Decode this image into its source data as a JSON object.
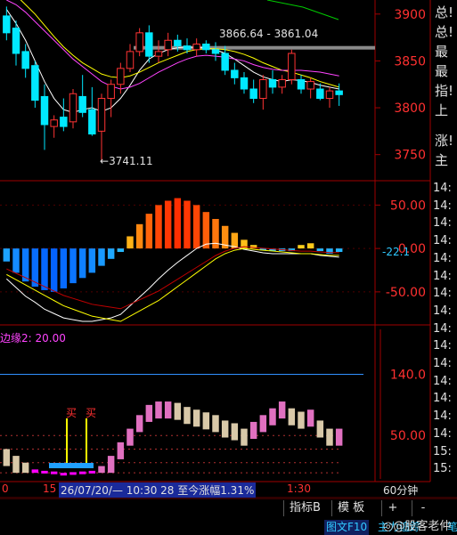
{
  "price_axis": {
    "ticks": [
      "3900",
      "3850",
      "3800",
      "3750"
    ]
  },
  "price_annotations": {
    "range_label": "3866.64 - 3861.04",
    "low_label": "3741.11"
  },
  "macd_axis": {
    "ticks": [
      "50.00",
      "0.00",
      "-50.00"
    ],
    "current_value": "-22.1"
  },
  "indicator_panel": {
    "title": "边缘2: 20.00",
    "ticks": [
      "140.0",
      "50.00"
    ],
    "buy_labels": [
      "买",
      "买"
    ]
  },
  "status_bar": {
    "left_text": "0",
    "left_text2": "15",
    "info_text": "26/07/20/— 10:30 28 至今涨幅1.31%",
    "time_text": "1:30",
    "period": "60分钟"
  },
  "right_panel": {
    "labels": [
      "总!",
      "总!",
      "最",
      "最",
      "指!",
      "上",
      "涨!",
      "主"
    ],
    "times": [
      "14:",
      "14:",
      "14:",
      "14:",
      "14:",
      "14:",
      "14:",
      "14:",
      "14:",
      "14:",
      "14:",
      "14:",
      "14:",
      "14:",
      "14:",
      "15:",
      "15:"
    ]
  },
  "bottom_buttons": {
    "indicator": "指标B",
    "template": "模 板",
    "plus": "+",
    "minus": "-"
  },
  "footer": {
    "tabs": "图文F10",
    "item2": "主力追踪",
    "item3": "笔"
  },
  "watermark": "股客老仲",
  "colors": {
    "up": "#ff3333",
    "down": "#00e8ff",
    "up_candle_fill": "#000000",
    "down_candle_fill": "#00e8ff"
  },
  "chart_data": [
    {
      "type": "candlestick",
      "title": "",
      "ylim": [
        3725,
        3915
      ],
      "yticks": [
        3900,
        3850,
        3800,
        3750
      ],
      "candles": [
        {
          "o": 3898,
          "h": 3908,
          "l": 3872,
          "c": 3880
        },
        {
          "o": 3885,
          "h": 3893,
          "l": 3845,
          "c": 3858
        },
        {
          "o": 3860,
          "h": 3868,
          "l": 3832,
          "c": 3842
        },
        {
          "o": 3845,
          "h": 3850,
          "l": 3800,
          "c": 3808
        },
        {
          "o": 3812,
          "h": 3825,
          "l": 3755,
          "c": 3782
        },
        {
          "o": 3780,
          "h": 3792,
          "l": 3768,
          "c": 3787
        },
        {
          "o": 3790,
          "h": 3810,
          "l": 3775,
          "c": 3780
        },
        {
          "o": 3785,
          "h": 3820,
          "l": 3778,
          "c": 3815
        },
        {
          "o": 3812,
          "h": 3835,
          "l": 3790,
          "c": 3795
        },
        {
          "o": 3798,
          "h": 3822,
          "l": 3770,
          "c": 3772
        },
        {
          "o": 3775,
          "h": 3815,
          "l": 3742,
          "c": 3810
        },
        {
          "o": 3810,
          "h": 3830,
          "l": 3790,
          "c": 3825
        },
        {
          "o": 3825,
          "h": 3848,
          "l": 3815,
          "c": 3842
        },
        {
          "o": 3842,
          "h": 3868,
          "l": 3838,
          "c": 3860
        },
        {
          "o": 3860,
          "h": 3885,
          "l": 3855,
          "c": 3880
        },
        {
          "o": 3880,
          "h": 3888,
          "l": 3848,
          "c": 3855
        },
        {
          "o": 3855,
          "h": 3872,
          "l": 3848,
          "c": 3860
        },
        {
          "o": 3862,
          "h": 3880,
          "l": 3855,
          "c": 3872
        },
        {
          "o": 3872,
          "h": 3878,
          "l": 3860,
          "c": 3866
        },
        {
          "o": 3866,
          "h": 3874,
          "l": 3858,
          "c": 3862
        },
        {
          "o": 3862,
          "h": 3874,
          "l": 3855,
          "c": 3868
        },
        {
          "o": 3868,
          "h": 3872,
          "l": 3858,
          "c": 3862
        },
        {
          "o": 3862,
          "h": 3870,
          "l": 3850,
          "c": 3858
        },
        {
          "o": 3858,
          "h": 3866,
          "l": 3835,
          "c": 3840
        },
        {
          "o": 3840,
          "h": 3848,
          "l": 3825,
          "c": 3832
        },
        {
          "o": 3832,
          "h": 3838,
          "l": 3815,
          "c": 3820
        },
        {
          "o": 3820,
          "h": 3830,
          "l": 3805,
          "c": 3810
        },
        {
          "o": 3810,
          "h": 3835,
          "l": 3798,
          "c": 3830
        },
        {
          "o": 3830,
          "h": 3840,
          "l": 3815,
          "c": 3822
        },
        {
          "o": 3822,
          "h": 3835,
          "l": 3815,
          "c": 3830
        },
        {
          "o": 3830,
          "h": 3862,
          "l": 3825,
          "c": 3858
        },
        {
          "o": 3830,
          "h": 3835,
          "l": 3815,
          "c": 3820
        },
        {
          "o": 3820,
          "h": 3832,
          "l": 3810,
          "c": 3828
        },
        {
          "o": 3820,
          "h": 3826,
          "l": 3808,
          "c": 3810
        },
        {
          "o": 3810,
          "h": 3822,
          "l": 3800,
          "c": 3818
        },
        {
          "o": 3818,
          "h": 3826,
          "l": 3802,
          "c": 3814
        }
      ],
      "ma_series": [
        {
          "color": "#ffffff",
          "values": [
            3905,
            3890,
            3872,
            3850,
            3828,
            3810,
            3798,
            3795,
            3798,
            3800,
            3796,
            3800,
            3810,
            3824,
            3840,
            3852,
            3858,
            3862,
            3864,
            3865,
            3864,
            3864,
            3862,
            3858,
            3852,
            3845,
            3838,
            3833,
            3830,
            3828,
            3830,
            3829,
            3827,
            3824,
            3822,
            3820
          ]
        },
        {
          "color": "#ffff00",
          "values": [
            3930,
            3920,
            3910,
            3900,
            3888,
            3876,
            3865,
            3856,
            3848,
            3842,
            3836,
            3833,
            3832,
            3834,
            3838,
            3843,
            3848,
            3852,
            3856,
            3860,
            3862,
            3863,
            3863,
            3862,
            3860,
            3857,
            3853,
            3848,
            3844,
            3840,
            3838,
            3835,
            3832,
            3828,
            3825,
            3822
          ]
        },
        {
          "color": "#ff44ff",
          "values": [
            3915,
            3910,
            3902,
            3892,
            3882,
            3872,
            3862,
            3852,
            3844,
            3836,
            3828,
            3823,
            3820,
            3822,
            3826,
            3832,
            3838,
            3843,
            3848,
            3852,
            3855,
            3856,
            3855,
            3854,
            3852,
            3850,
            3846,
            3843,
            3841,
            3840,
            3840,
            3840,
            3839,
            3838,
            3836,
            3834
          ]
        },
        {
          "color": "#00cc00",
          "values": [
            null,
            null,
            null,
            null,
            null,
            null,
            null,
            null,
            null,
            null,
            null,
            null,
            null,
            null,
            null,
            null,
            null,
            null,
            null,
            null,
            null,
            null,
            null,
            null,
            null,
            null,
            null,
            null,
            null,
            null,
            null,
            null,
            null,
            null,
            null,
            null
          ]
        }
      ]
    },
    {
      "type": "bar",
      "title": "MACD",
      "ylim": [
        -85,
        75
      ],
      "yticks": [
        50,
        0,
        -50
      ],
      "values": [
        -15,
        -28,
        -38,
        -44,
        -48,
        -50,
        -46,
        -40,
        -34,
        -28,
        -20,
        -12,
        -4,
        14,
        28,
        40,
        50,
        55,
        58,
        55,
        50,
        42,
        34,
        26,
        18,
        10,
        4,
        -2,
        -3,
        -3,
        -3,
        4,
        6,
        -3,
        -6,
        -4
      ],
      "dif": [
        -35,
        -45,
        -55,
        -62,
        -70,
        -75,
        -80,
        -82,
        -84,
        -84,
        -82,
        -80,
        -76,
        -66,
        -56,
        -46,
        -35,
        -25,
        -16,
        -8,
        0,
        5,
        6,
        4,
        2,
        -1,
        -3,
        -5,
        -6,
        -6,
        -6,
        -6,
        -6,
        -8,
        -9,
        -10
      ],
      "dea": [
        -30,
        -36,
        -42,
        -48,
        -54,
        -60,
        -66,
        -70,
        -74,
        -78,
        -80,
        -82,
        -84,
        -78,
        -72,
        -66,
        -60,
        -52,
        -44,
        -36,
        -28,
        -20,
        -12,
        -6,
        -2,
        0,
        -1,
        -2,
        -3,
        -4,
        -5,
        -6,
        -6,
        -7,
        -8,
        -8
      ]
    },
    {
      "type": "bar",
      "title": "边缘2",
      "ylim": [
        -10,
        180
      ],
      "yticks": [
        140,
        50
      ],
      "reference_lines": [
        140,
        50
      ],
      "values": [
        30,
        20,
        10,
        0,
        -2,
        -3,
        -5,
        -4,
        -3,
        -2,
        5,
        20,
        40,
        60,
        80,
        95,
        100,
        100,
        98,
        92,
        88,
        84,
        80,
        72,
        68,
        60,
        70,
        80,
        90,
        100,
        90,
        85,
        88,
        72,
        60,
        60
      ]
    }
  ]
}
